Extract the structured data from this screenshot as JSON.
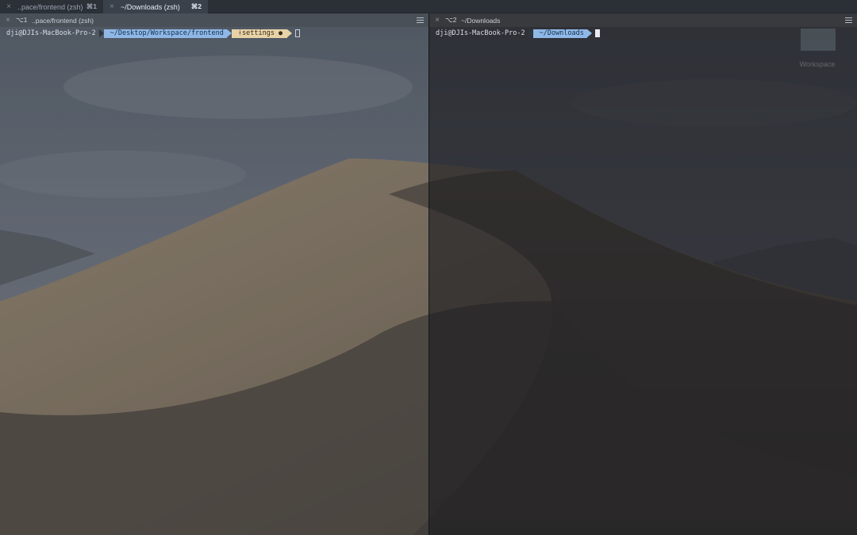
{
  "tabs": [
    {
      "title": "..pace/frontend (zsh)",
      "shortcut": "⌘1",
      "active": false
    },
    {
      "title": "~/Downloads (zsh)",
      "shortcut": "⌘2",
      "active": true
    }
  ],
  "panes": {
    "left": {
      "number": "⌥1",
      "title": "..pace/frontend (zsh)",
      "prompt": {
        "user": "dji@DJIs-MacBook-Pro-2",
        "path": "~/Desktop/Workspace/frontend",
        "git": " settings ●"
      }
    },
    "right": {
      "number": "⌥2",
      "title": "~/Downloads",
      "prompt": {
        "user": "dji@DJIs-MacBook-Pro-2",
        "path": "~/Downloads"
      }
    }
  },
  "desktop": {
    "icon_label": "Workspace"
  },
  "colors": {
    "path_segment": "#8fb8e6",
    "git_segment": "#e8d2a8",
    "tab_active": "#3a414b"
  }
}
